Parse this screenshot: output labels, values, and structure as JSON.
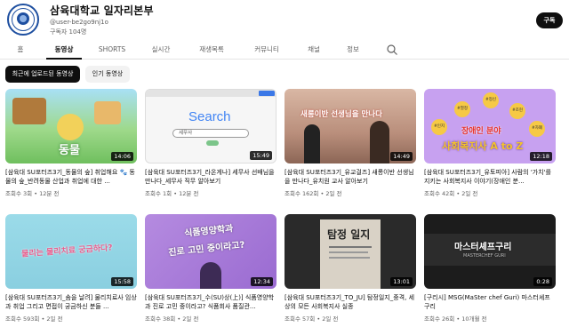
{
  "channel": {
    "name": "삼육대학교 일자리본부",
    "handle": "@user-be2go9nj1o",
    "subscribers": "구독자 104명",
    "subscribe_label": "구독"
  },
  "tabs": [
    {
      "label": "홈"
    },
    {
      "label": "동영상"
    },
    {
      "label": "SHORTS"
    },
    {
      "label": "실시간"
    },
    {
      "label": "재생목록"
    },
    {
      "label": "커뮤니티"
    },
    {
      "label": "채널"
    },
    {
      "label": "정보"
    }
  ],
  "chips": [
    {
      "label": "최근에 업로드된 동영상"
    },
    {
      "label": "인기 동영상"
    }
  ],
  "videos": [
    {
      "title": "[삼육대 SU포터즈3기_동물의 숲] 취업해요 🐾 동물의 숲_반려동물 산업과 취업에 대한 ...",
      "meta": "조회수 3회 • 12분 전",
      "duration": "14:06",
      "thumb_text": "동물",
      "thumb_color": "#7bc96f"
    },
    {
      "title": "[삼육대 SU포터즈3기_라온게나] 세무사 선배님을 만나다_세무사 직무 알아보기",
      "meta": "조회수 1회 • 12분 전",
      "duration": "15:49",
      "thumb_text": "Search",
      "thumb_color": "#f4f4f4",
      "search_placeholder": "세무사"
    },
    {
      "title": "[삼육대 SU포터즈3기_유교걸즈] 새롱이반 선생님을 만나다_유치원 교사 알아보기",
      "meta": "조회수 162회 • 2일 전",
      "duration": "14:49",
      "thumb_text": "새롱이반 선생님을 만나다",
      "thumb_color": "#c79a88"
    },
    {
      "title": "[삼육대 SU포터즈3기_유토피아] 사람의 '가치'를 지키는 사회복지사 이야기(장애인 분...",
      "meta": "조회수 42회 • 2일 전",
      "duration": "12:18",
      "thumb_text": "장애인 분야",
      "thumb_text2": "사회복지사 A to Z",
      "thumb_color": "#c9a3f2",
      "tags": [
        "#열정",
        "#정신",
        "#조현",
        "#인지",
        "#자폐"
      ]
    },
    {
      "title": "[삼육대 SU포터즈3기_솜을 날려] 물리치료사 임상과 취업 그리고 면접이 궁금하신 분들 ...",
      "meta": "조회수 593회 • 2일 전",
      "duration": "15:58",
      "thumb_text": "물리는 물리치료 궁금하다?",
      "thumb_color": "#8fd3e3"
    },
    {
      "title": "[삼육대 SU포터즈3기_수(SU)상(上)] 식품영양학과 진로 고민 중이라고? 식품회사 품질관...",
      "meta": "조회수 38회 • 2일 전",
      "duration": "12:34",
      "thumb_text": "식품영양학과",
      "thumb_text2": "진로 고민 중이라고?",
      "thumb_color": "#a478d8"
    },
    {
      "title": "[삼육대 SU포터즈3기_TO_JU] 탐정일지_중격, 세상의 모든 사회복지사 실종",
      "meta": "조회수 57회 • 2일 전",
      "duration": "13:01",
      "thumb_text": "탐정 일지",
      "thumb_color": "#2b2b2b"
    },
    {
      "title": "[구리시] MSG(MaSter chef Guri) 마스터셰프 구리",
      "meta": "조회수 26회 • 10개월 전",
      "duration": "0:28",
      "thumb_text": "마스터셰프구리",
      "thumb_text2": "MASTERCHEF GURI",
      "thumb_color": "#1f1f1f"
    }
  ]
}
